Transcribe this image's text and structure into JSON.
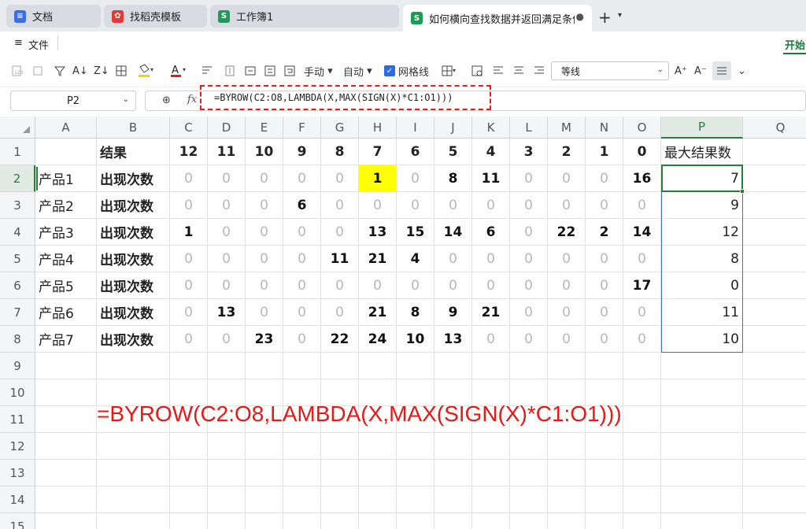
{
  "tabs": [
    {
      "label": "文档",
      "icon": "doc-icon",
      "color": "#3b6fe0"
    },
    {
      "label": "找稻壳模板",
      "icon": "docer-icon",
      "color": "#e03a3a"
    },
    {
      "label": "工作簿1",
      "icon": "sheet-icon",
      "color": "#1f9a57"
    },
    {
      "label": "如何横向查找数据并返回满足条件",
      "icon": "sheet-icon",
      "color": "#1f9a57",
      "active": true
    }
  ],
  "menu": {
    "file": "文件",
    "start": "开始"
  },
  "toolbar": {
    "fill_handle": "手动",
    "auto": "自动",
    "gridlines": "网格线",
    "gridlines_checked": true,
    "font_name": "等线"
  },
  "name_box": "P2",
  "formula": "=BYROW(C2:O8,LAMBDA(X,MAX(SIGN(X)*C1:O1)))",
  "columns": [
    "A",
    "B",
    "C",
    "D",
    "E",
    "F",
    "G",
    "H",
    "I",
    "J",
    "K",
    "L",
    "M",
    "N",
    "O",
    "P",
    "Q"
  ],
  "rows": [
    "1",
    "2",
    "3",
    "4",
    "5",
    "6",
    "7",
    "8",
    "9",
    "10",
    "11",
    "12",
    "13",
    "14",
    "15"
  ],
  "header_row": {
    "b": "结果",
    "values": [
      "12",
      "11",
      "10",
      "9",
      "8",
      "7",
      "6",
      "5",
      "4",
      "3",
      "2",
      "1",
      "0"
    ],
    "p": "最大结果数"
  },
  "data_rows": [
    {
      "a": "产品1",
      "b": "出现次数",
      "values": [
        "0",
        "0",
        "0",
        "0",
        "0",
        "1",
        "0",
        "8",
        "11",
        "0",
        "0",
        "0",
        "16"
      ],
      "p": "7"
    },
    {
      "a": "产品2",
      "b": "出现次数",
      "values": [
        "0",
        "0",
        "0",
        "6",
        "0",
        "0",
        "0",
        "0",
        "0",
        "0",
        "0",
        "0",
        "0"
      ],
      "p": "9"
    },
    {
      "a": "产品3",
      "b": "出现次数",
      "values": [
        "1",
        "0",
        "0",
        "0",
        "0",
        "13",
        "15",
        "14",
        "6",
        "0",
        "22",
        "2",
        "14"
      ],
      "p": "12"
    },
    {
      "a": "产品4",
      "b": "出现次数",
      "values": [
        "0",
        "0",
        "0",
        "0",
        "11",
        "21",
        "4",
        "0",
        "0",
        "0",
        "0",
        "0",
        "0"
      ],
      "p": "8"
    },
    {
      "a": "产品5",
      "b": "出现次数",
      "values": [
        "0",
        "0",
        "0",
        "0",
        "0",
        "0",
        "0",
        "0",
        "0",
        "0",
        "0",
        "0",
        "17"
      ],
      "p": "0"
    },
    {
      "a": "产品6",
      "b": "出现次数",
      "values": [
        "0",
        "13",
        "0",
        "0",
        "0",
        "21",
        "8",
        "9",
        "21",
        "0",
        "0",
        "0",
        "0"
      ],
      "p": "11"
    },
    {
      "a": "产品7",
      "b": "出现次数",
      "values": [
        "0",
        "0",
        "23",
        "0",
        "22",
        "24",
        "10",
        "13",
        "0",
        "0",
        "0",
        "0",
        "0"
      ],
      "p": "10"
    }
  ],
  "annotation": "=BYROW(C2:O8,LAMBDA(X,MAX(SIGN(X)*C1:O1)))",
  "colors": {
    "accent": "#2a7a3a",
    "highlight": "#ffff00",
    "annotation": "#e81818",
    "selection": "#3a6ed8"
  }
}
